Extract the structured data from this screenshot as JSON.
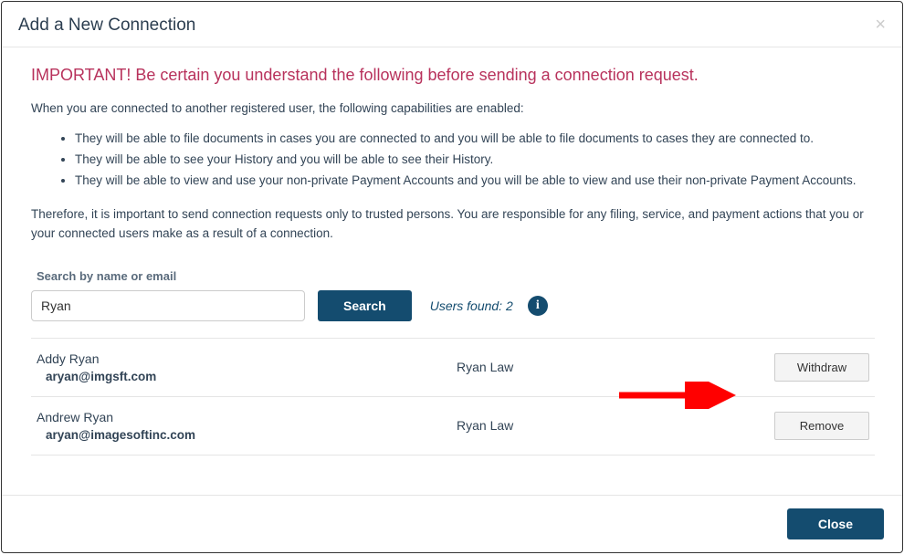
{
  "modal": {
    "title": "Add a New Connection",
    "close_x": "×"
  },
  "warning": {
    "heading": "IMPORTANT! Be certain you understand the following before sending a connection request.",
    "intro": "When you are connected to another registered user, the following capabilities are enabled:",
    "bullets": [
      "They will be able to file documents in cases you are connected to and you will be able to file documents to cases they are connected to.",
      "They will be able to see your History and you will be able to see their History.",
      "They will be able to view and use your non-private Payment Accounts and you will be able to view and use their non-private Payment Accounts."
    ],
    "therefore": "Therefore, it is important to send connection requests only to trusted persons. You are responsible for any filing, service, and payment actions that you or your connected users make as a result of a connection."
  },
  "search": {
    "label": "Search by name or email",
    "value": "Ryan",
    "button": "Search",
    "found_text": "Users found: 2",
    "info_glyph": "i"
  },
  "results": [
    {
      "name": "Addy Ryan",
      "email": "aryan@imgsft.com",
      "org": "Ryan Law",
      "action": "Withdraw"
    },
    {
      "name": "Andrew Ryan",
      "email": "aryan@imagesoftinc.com",
      "org": "Ryan Law",
      "action": "Remove"
    }
  ],
  "footer": {
    "close": "Close"
  },
  "colors": {
    "primary": "#144c6f",
    "danger_text": "#b8325c",
    "arrow": "#ff0000"
  }
}
